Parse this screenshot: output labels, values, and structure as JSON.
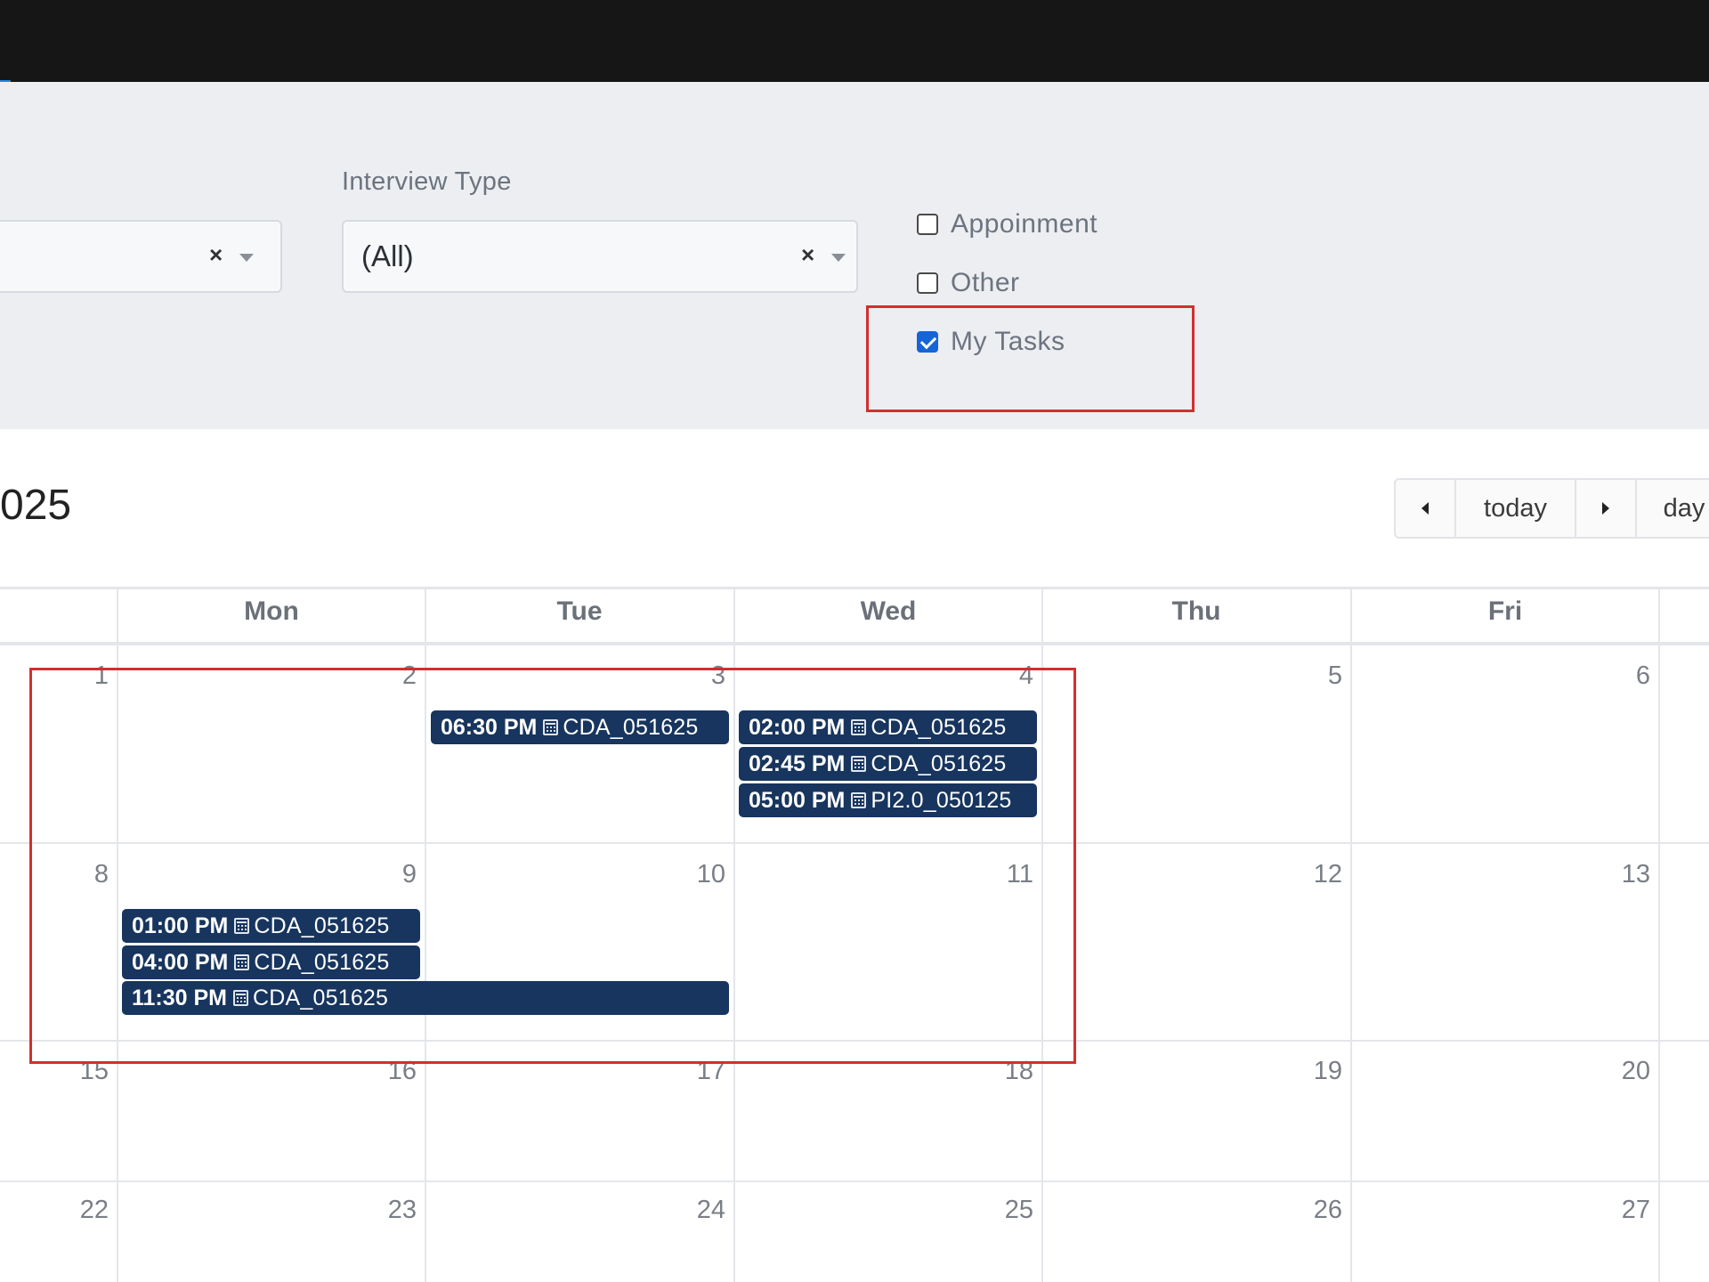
{
  "filters": {
    "left_select": {
      "value": "",
      "clear_symbol": "×"
    },
    "interview_type": {
      "label": "Interview Type",
      "value": "(All)",
      "clear_symbol": "×"
    },
    "checkboxes": [
      {
        "label": "Appoinment",
        "checked": false
      },
      {
        "label": "Other",
        "checked": false
      },
      {
        "label": "My Tasks",
        "checked": true
      }
    ]
  },
  "calendar": {
    "title": "025",
    "toolbar": {
      "prev_icon": "caret-left-icon",
      "today": "today",
      "next_icon": "caret-right-icon",
      "day": "day"
    },
    "weekdays": [
      "Mon",
      "Tue",
      "Wed",
      "Thu",
      "Fri"
    ],
    "weeks": [
      [
        "1",
        "2",
        "3",
        "4",
        "5",
        "6"
      ],
      [
        "8",
        "9",
        "10",
        "11",
        "12",
        "13"
      ],
      [
        "15",
        "16",
        "17",
        "18",
        "19",
        "20"
      ],
      [
        "22",
        "23",
        "24",
        "25",
        "26",
        "27"
      ]
    ],
    "events": [
      {
        "time": "06:30 PM",
        "title": "CDA_051625",
        "icon": "calendar-icon"
      },
      {
        "time": "02:00 PM",
        "title": "CDA_051625",
        "icon": "calendar-icon"
      },
      {
        "time": "02:45 PM",
        "title": "CDA_051625",
        "icon": "calendar-icon"
      },
      {
        "time": "05:00 PM",
        "title": "PI2.0_050125",
        "icon": "calendar-icon"
      },
      {
        "time": "01:00 PM",
        "title": "CDA_051625",
        "icon": "calendar-icon"
      },
      {
        "time": "04:00 PM",
        "title": "CDA_051625",
        "icon": "calendar-icon"
      },
      {
        "time": "11:30 PM",
        "title": "CDA_051625",
        "icon": "calendar-icon"
      }
    ],
    "event_color": "#17355e"
  },
  "annotation_color": "#d32f2f",
  "checkbox_accent": "#1565d8"
}
